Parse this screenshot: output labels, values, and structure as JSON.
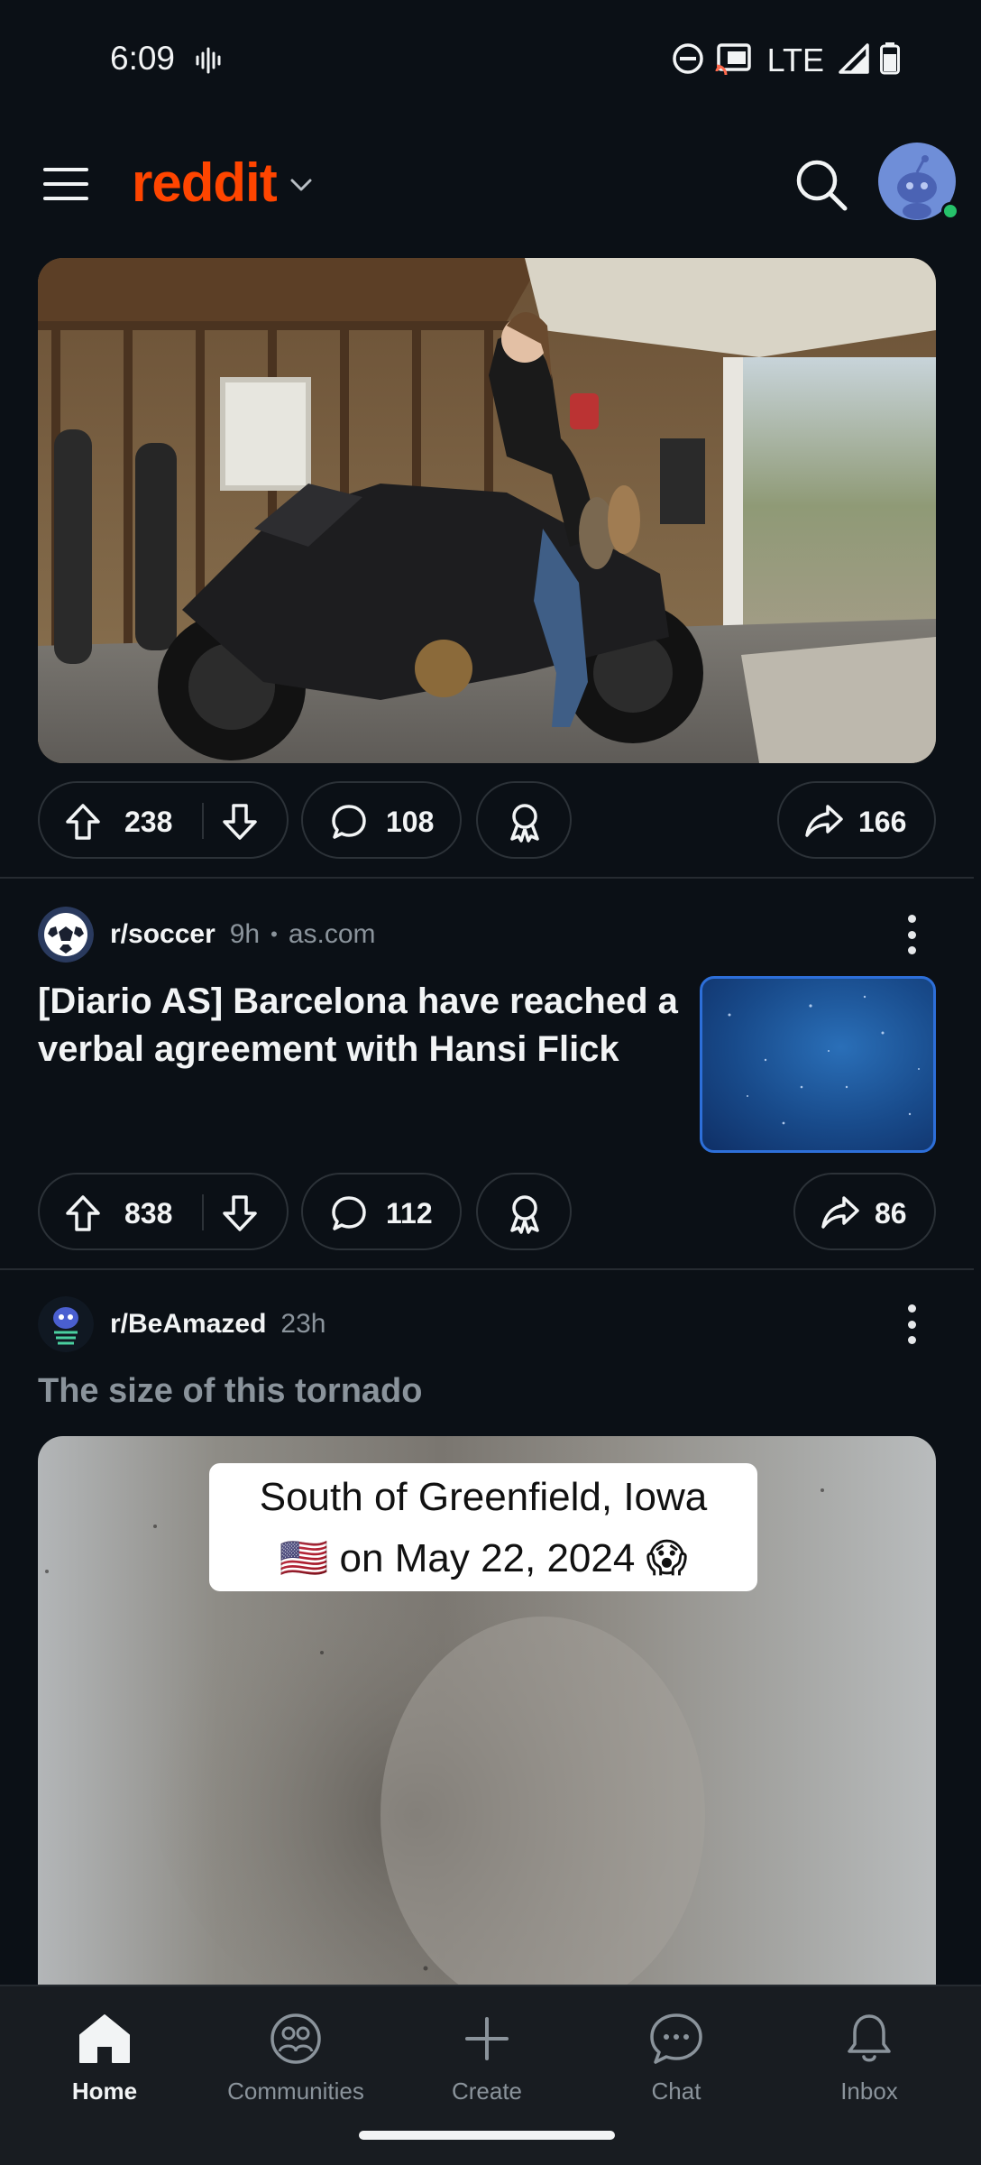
{
  "status_bar": {
    "time": "6:09",
    "network": "LTE"
  },
  "app_bar": {
    "logo": "reddit"
  },
  "posts": [
    {
      "votes": "238",
      "comments": "108",
      "shares": "166"
    },
    {
      "subreddit": "r/soccer",
      "age": "9h",
      "domain_sep": "•",
      "domain": "as.com",
      "title_line1": "[Diario AS] Barcelona have reached a",
      "title_line2": "verbal agreement with Hansi Flick",
      "votes": "838",
      "comments": "112",
      "shares": "86"
    },
    {
      "subreddit": "r/BeAmazed",
      "age": "23h",
      "title": "The size of this tornado",
      "caption_line1": "South of Greenfield, Iowa",
      "caption_line2": "🇺🇸 on May 22, 2024 😱"
    }
  ],
  "bottom_nav": [
    {
      "label": "Home",
      "icon": "home-icon"
    },
    {
      "label": "Communities",
      "icon": "communities-icon"
    },
    {
      "label": "Create",
      "icon": "plus-icon"
    },
    {
      "label": "Chat",
      "icon": "chat-icon"
    },
    {
      "label": "Inbox",
      "icon": "bell-icon"
    }
  ],
  "colors": {
    "brand": "#ff4500",
    "background": "#0b1016",
    "thumb_border": "#2d6fd9"
  }
}
